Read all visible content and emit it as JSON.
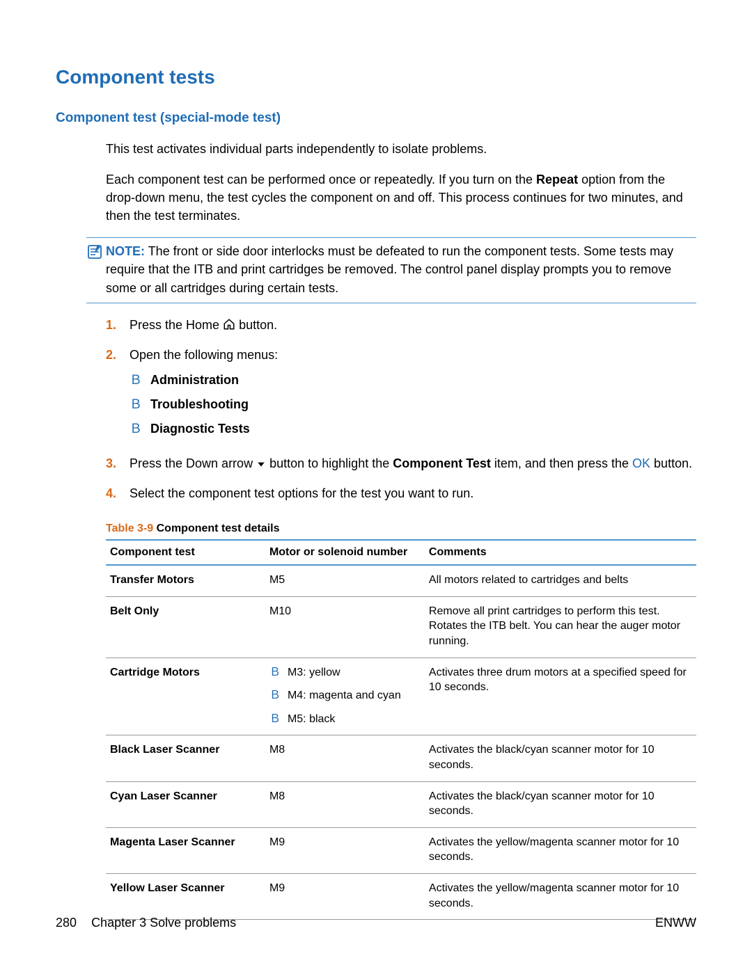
{
  "headings": {
    "h1": "Component tests",
    "h2": "Component test (special-mode test)"
  },
  "paragraphs": {
    "p1": "This test activates individual parts independently to isolate problems.",
    "p2a": "Each component test can be performed once or repeatedly. If you turn on the ",
    "p2b_bold": "Repeat",
    "p2c": " option from the drop-down menu, the test cycles the component on and off. This process continues for two minutes, and then the test terminates."
  },
  "note": {
    "label": "NOTE:",
    "text": "The front or side door interlocks must be defeated to run the component tests. Some tests may require that the ITB and print cartridges be removed. The control panel display prompts you to remove some or all cartridges during certain tests."
  },
  "steps": {
    "s1_num": "1.",
    "s1_a": "Press the Home ",
    "s1_b": " button.",
    "s2_num": "2.",
    "s2_text": "Open the following menus:",
    "menu": {
      "bullet": "Ｂ",
      "m1": "Administration",
      "m2": "Troubleshooting",
      "m3": "Diagnostic Tests"
    },
    "s3_num": "3.",
    "s3_a": "Press the Down arrow ",
    "s3_b": " button to highlight the ",
    "s3_bold": "Component Test",
    "s3_c": " item, and then press the ",
    "s3_ok": "OK",
    "s3_d": " button.",
    "s4_num": "4.",
    "s4_text": "Select the component test options for the test you want to run."
  },
  "table": {
    "caption_num": "Table 3-9",
    "caption_title": "  Component test details",
    "headers": {
      "h0": "Component test",
      "h1": "Motor or solenoid number",
      "h2": "Comments"
    },
    "rows": [
      {
        "c0": "Transfer Motors",
        "c1": "M5",
        "c2": "All motors related to cartridges and belts"
      },
      {
        "c0": "Belt Only",
        "c1": "M10",
        "c2": "Remove all print cartridges to perform this test. Rotates the ITB belt. You can hear the auger motor running."
      },
      {
        "c0": "Cartridge Motors",
        "c1_list": [
          "M3: yellow",
          "M4: magenta and cyan",
          "M5: black"
        ],
        "c2": "Activates three drum motors at a specified speed for 10 seconds."
      },
      {
        "c0": "Black Laser Scanner",
        "c1": "M8",
        "c2": "Activates the black/cyan scanner motor for 10 seconds."
      },
      {
        "c0": "Cyan Laser Scanner",
        "c1": "M8",
        "c2": "Activates the black/cyan scanner motor for 10 seconds."
      },
      {
        "c0": "Magenta Laser Scanner",
        "c1": "M9",
        "c2": "Activates the yellow/magenta scanner motor for 10 seconds."
      },
      {
        "c0": "Yellow Laser Scanner",
        "c1": "M9",
        "c2": "Activates the yellow/magenta scanner motor for 10 seconds."
      }
    ],
    "bullet": "Ｂ"
  },
  "footer": {
    "page_num": "280",
    "chapter": "Chapter 3   Solve problems",
    "right": "ENWW"
  }
}
